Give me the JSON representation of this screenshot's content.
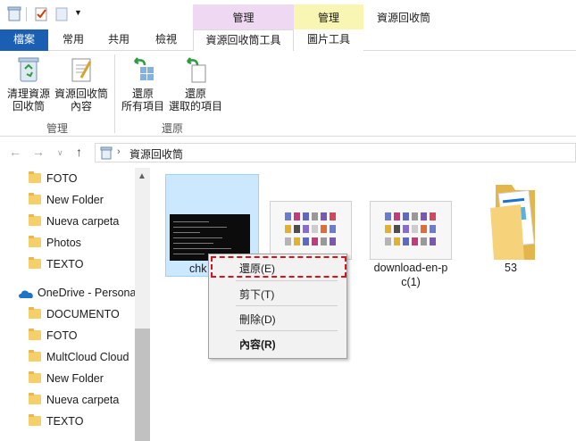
{
  "titlebar": {
    "context_manage_1": "管理",
    "context_manage_2": "管理",
    "window_title": "資源回收筒",
    "ctx_colors": {
      "recycle": "#efd9f2",
      "picture": "#f9f6b3"
    }
  },
  "tabs": {
    "file": "檔案",
    "home": "常用",
    "share": "共用",
    "view": "檢視",
    "recycle_tools": "資源回收筒工具",
    "picture_tools": "圖片工具"
  },
  "ribbon": {
    "empty_bin": [
      "清理資源",
      "回收筒"
    ],
    "bin_properties": [
      "資源回收筒",
      "內容"
    ],
    "group_manage": "管理",
    "restore_all": [
      "還原",
      "所有項目"
    ],
    "restore_selected": [
      "還原",
      "選取的項目"
    ],
    "group_restore": "還原"
  },
  "address": {
    "back_icon": "arrow-left-icon",
    "path": "資源回收筒"
  },
  "sidebar": {
    "items_top": [
      "FOTO",
      "New Folder",
      "Nueva carpeta",
      "Photos",
      "TEXTO"
    ],
    "onedrive": "OneDrive - Persona",
    "items_bottom": [
      "DOCUMENTO",
      "FOTO",
      "MultCloud Cloud",
      "New Folder",
      "Nueva carpeta",
      "TEXTO"
    ]
  },
  "files": [
    {
      "name": "chk"
    },
    {
      "name": "p"
    },
    {
      "name": "download-en-p",
      "name2": "c(1)"
    },
    {
      "name": "53"
    }
  ],
  "context_menu": {
    "restore": "還原(E)",
    "cut": "剪下(T)",
    "delete": "刪除(D)",
    "properties": "內容(R)"
  }
}
